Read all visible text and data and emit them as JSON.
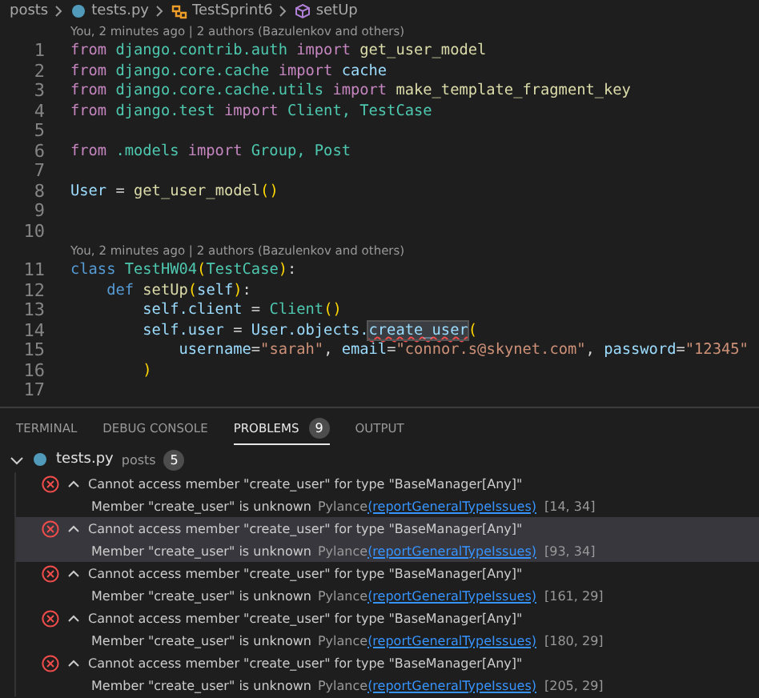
{
  "breadcrumb": [
    {
      "label": "posts",
      "kind": "folder"
    },
    {
      "label": "tests.py",
      "kind": "python"
    },
    {
      "label": "TestSprint6",
      "kind": "class"
    },
    {
      "label": "setUp",
      "kind": "method"
    }
  ],
  "editor": {
    "lines": [
      {
        "kind": "lens",
        "text": "You, 2 minutes ago | 2 authors (Bazulenkov and others)"
      },
      {
        "kind": "code",
        "number": "1",
        "tokens": [
          {
            "t": "from",
            "kind": "kw"
          },
          {
            "t": " django.contrib.auth",
            "kind": "mod"
          },
          {
            "t": " import",
            "kind": "kw"
          },
          {
            "t": " get_user_model",
            "kind": "fn"
          }
        ]
      },
      {
        "kind": "code",
        "number": "2",
        "tokens": [
          {
            "t": "from",
            "kind": "kw"
          },
          {
            "t": " django.core.cache",
            "kind": "mod"
          },
          {
            "t": " import",
            "kind": "kw"
          },
          {
            "t": " cache",
            "kind": "var"
          }
        ]
      },
      {
        "kind": "code",
        "number": "3",
        "tokens": [
          {
            "t": "from",
            "kind": "kw"
          },
          {
            "t": " django.core.cache.utils",
            "kind": "mod"
          },
          {
            "t": " import",
            "kind": "kw"
          },
          {
            "t": " make_template_fragment_key",
            "kind": "fn"
          }
        ]
      },
      {
        "kind": "code",
        "number": "4",
        "tokens": [
          {
            "t": "from",
            "kind": "kw"
          },
          {
            "t": " django.test",
            "kind": "mod"
          },
          {
            "t": " import",
            "kind": "kw"
          },
          {
            "t": " Client, TestCase",
            "kind": "cls"
          }
        ]
      },
      {
        "kind": "code",
        "number": "5"
      },
      {
        "kind": "code",
        "number": "6",
        "tokens": [
          {
            "t": "from",
            "kind": "kw"
          },
          {
            "t": " .models",
            "kind": "mod"
          },
          {
            "t": " import",
            "kind": "kw"
          },
          {
            "t": " Group, Post",
            "kind": "cls"
          }
        ]
      },
      {
        "kind": "code",
        "number": "7"
      },
      {
        "kind": "code",
        "number": "8",
        "tokens": [
          {
            "t": "User",
            "kind": "var"
          },
          {
            "t": " = ",
            "kind": "plain"
          },
          {
            "t": "get_user_model",
            "kind": "fn"
          },
          {
            "t": "()",
            "kind": "paren"
          }
        ]
      },
      {
        "kind": "code",
        "number": "9"
      },
      {
        "kind": "code",
        "number": "10"
      },
      {
        "kind": "lens",
        "text": "You, 2 minutes ago | 2 authors (Bazulenkov and others)"
      },
      {
        "kind": "code",
        "number": "11",
        "tokens": [
          {
            "t": "class",
            "kind": "def"
          },
          {
            "t": " TestHW04",
            "kind": "cls"
          },
          {
            "t": "(",
            "kind": "paren"
          },
          {
            "t": "TestCase",
            "kind": "cls"
          },
          {
            "t": ")",
            "kind": "paren"
          },
          {
            "t": ":",
            "kind": "plain"
          }
        ]
      },
      {
        "kind": "code",
        "number": "12",
        "tokens": [
          {
            "t": "    def",
            "kind": "def"
          },
          {
            "t": " setUp",
            "kind": "fn"
          },
          {
            "t": "(",
            "kind": "paren"
          },
          {
            "t": "self",
            "kind": "var"
          },
          {
            "t": ")",
            "kind": "paren"
          },
          {
            "t": ":",
            "kind": "plain"
          }
        ]
      },
      {
        "kind": "code",
        "number": "13",
        "tokens": [
          {
            "t": "        self.client",
            "kind": "var"
          },
          {
            "t": " = ",
            "kind": "plain"
          },
          {
            "t": "Client",
            "kind": "cls"
          },
          {
            "t": "()",
            "kind": "paren"
          }
        ]
      },
      {
        "kind": "code",
        "number": "14",
        "tokens": [
          {
            "t": "        self.user",
            "kind": "var"
          },
          {
            "t": " = ",
            "kind": "plain"
          },
          {
            "t": "User.objects.",
            "kind": "var"
          },
          {
            "t": "create_user",
            "kind": "err"
          },
          {
            "t": "(",
            "kind": "paren"
          }
        ]
      },
      {
        "kind": "code",
        "number": "15",
        "tokens": [
          {
            "t": "            username",
            "kind": "var"
          },
          {
            "t": "=",
            "kind": "plain"
          },
          {
            "t": "\"sarah\"",
            "kind": "str"
          },
          {
            "t": ", ",
            "kind": "plain"
          },
          {
            "t": "email",
            "kind": "var"
          },
          {
            "t": "=",
            "kind": "plain"
          },
          {
            "t": "\"connor.s@skynet.com\"",
            "kind": "str"
          },
          {
            "t": ", ",
            "kind": "plain"
          },
          {
            "t": "password",
            "kind": "var"
          },
          {
            "t": "=",
            "kind": "plain"
          },
          {
            "t": "\"12345\"",
            "kind": "str"
          }
        ]
      },
      {
        "kind": "code",
        "number": "16",
        "tokens": [
          {
            "t": "        )",
            "kind": "paren"
          }
        ]
      },
      {
        "kind": "code",
        "number": "17"
      }
    ]
  },
  "panel": {
    "tabs": [
      {
        "label": "TERMINAL",
        "selected": false
      },
      {
        "label": "DEBUG CONSOLE",
        "selected": false
      },
      {
        "label": "PROBLEMS",
        "selected": true,
        "badge": "9"
      },
      {
        "label": "OUTPUT",
        "selected": false
      }
    ],
    "file": {
      "name": "tests.py",
      "folder": "posts",
      "count": "5",
      "expanded": true
    },
    "problems": [
      {
        "message": "Cannot access member \"create_user\" for type \"BaseManager[Any]\"",
        "detail": "Member \"create_user\" is unknown",
        "source": "Pylance",
        "rule": "(reportGeneralTypeIssues)",
        "position": "[14, 34]",
        "selected": false
      },
      {
        "message": "Cannot access member \"create_user\" for type \"BaseManager[Any]\"",
        "detail": "Member \"create_user\" is unknown",
        "source": "Pylance",
        "rule": "(reportGeneralTypeIssues)",
        "position": "[93, 34]",
        "selected": true
      },
      {
        "message": "Cannot access member \"create_user\" for type \"BaseManager[Any]\"",
        "detail": "Member \"create_user\" is unknown",
        "source": "Pylance",
        "rule": "(reportGeneralTypeIssues)",
        "position": "[161, 29]",
        "selected": false
      },
      {
        "message": "Cannot access member \"create_user\" for type \"BaseManager[Any]\"",
        "detail": "Member \"create_user\" is unknown",
        "source": "Pylance",
        "rule": "(reportGeneralTypeIssues)",
        "position": "[180, 29]",
        "selected": false
      },
      {
        "message": "Cannot access member \"create_user\" for type \"BaseManager[Any]\"",
        "detail": "Member \"create_user\" is unknown",
        "source": "Pylance",
        "rule": "(reportGeneralTypeIssues)",
        "position": "[205, 29]",
        "selected": false
      }
    ]
  }
}
